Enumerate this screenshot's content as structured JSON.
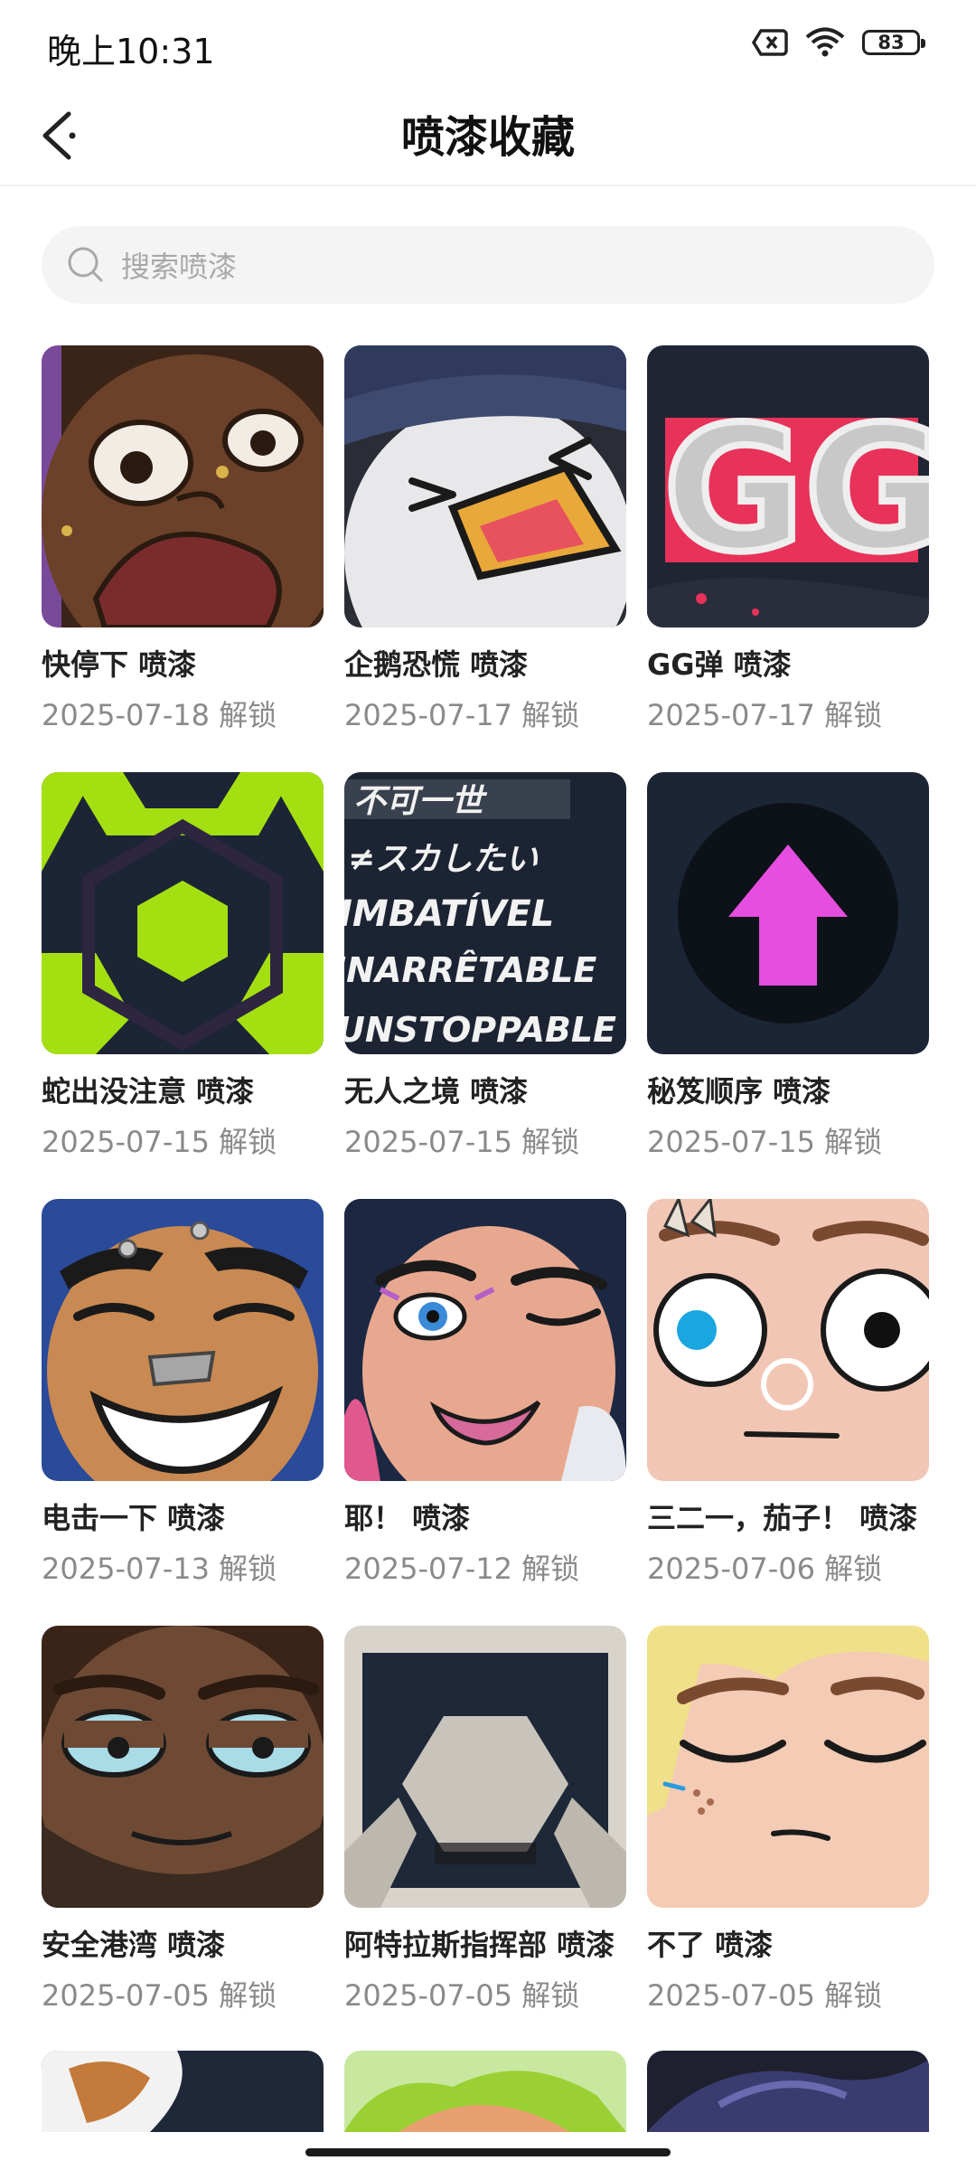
{
  "status_bar": {
    "time": "晚上10:31",
    "battery": "83"
  },
  "header": {
    "title": "喷漆收藏"
  },
  "search": {
    "placeholder": "搜索喷漆"
  },
  "sprays": [
    {
      "name": "快停下 喷漆",
      "date": "2025-07-18 解锁",
      "icon": "scared-face-icon"
    },
    {
      "name": "企鹅恐慌 喷漆",
      "date": "2025-07-17 解锁",
      "icon": "penguin-icon"
    },
    {
      "name": "GG弹 喷漆",
      "date": "2025-07-17 解锁",
      "icon": "gg-graffiti-icon"
    },
    {
      "name": "蛇出没注意 喷漆",
      "date": "2025-07-15 解锁",
      "icon": "hexagon-emblem-icon"
    },
    {
      "name": "无人之境 喷漆",
      "date": "2025-07-15 解锁",
      "icon": "text-stripes-icon"
    },
    {
      "name": "秘笈顺序 喷漆",
      "date": "2025-07-15 解锁",
      "icon": "arrow-up-icon"
    },
    {
      "name": "电击一下 喷漆",
      "date": "2025-07-13 解锁",
      "icon": "grinning-face-icon"
    },
    {
      "name": "耶！ 喷漆",
      "date": "2025-07-12 解锁",
      "icon": "winking-face-icon"
    },
    {
      "name": "三二一，茄子！ 喷漆",
      "date": "2025-07-06 解锁",
      "icon": "wide-eyes-face-icon"
    },
    {
      "name": "安全港湾 喷漆",
      "date": "2025-07-05 解锁",
      "icon": "bearded-face-icon"
    },
    {
      "name": "阿特拉斯指挥部 喷漆",
      "date": "2025-07-05 解锁",
      "icon": "hexagon-outline-icon"
    },
    {
      "name": "不了 喷漆",
      "date": "2025-07-05 解锁",
      "icon": "sleepy-face-icon"
    }
  ]
}
